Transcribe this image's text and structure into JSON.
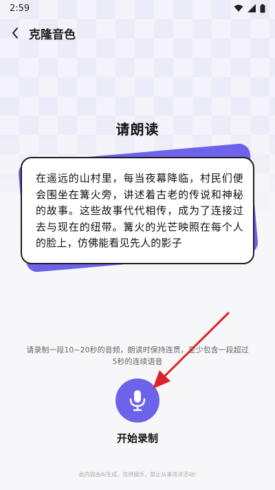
{
  "status": {
    "time": "2:59"
  },
  "header": {
    "title": "克隆音色",
    "back_icon": "chevron-left-icon"
  },
  "prompt": {
    "title": "请朗读"
  },
  "reading_card": {
    "text": "在遥远的山村里，每当夜幕降临，村民们便会围坐在篝火旁，讲述着古老的传说和神秘的故事。这些故事代代相传，成为了连接过去与现在的纽带。篝火的光芒映照在每个人的脸上，仿佛能看见先人的影子"
  },
  "hint": {
    "text": "请录制一段10~20秒的音频，朗读时保持连贯，至少包含一段超过5秒的连续语音"
  },
  "record": {
    "label": "开始录制",
    "icon": "microphone-icon",
    "color": "#6c63ea"
  },
  "footer": {
    "disclaimer": "此内容由AI生成，仅供娱乐，禁止从事违法活动!"
  },
  "colors": {
    "accent": "#6c63ea",
    "annotation_arrow": "#d8242b"
  }
}
